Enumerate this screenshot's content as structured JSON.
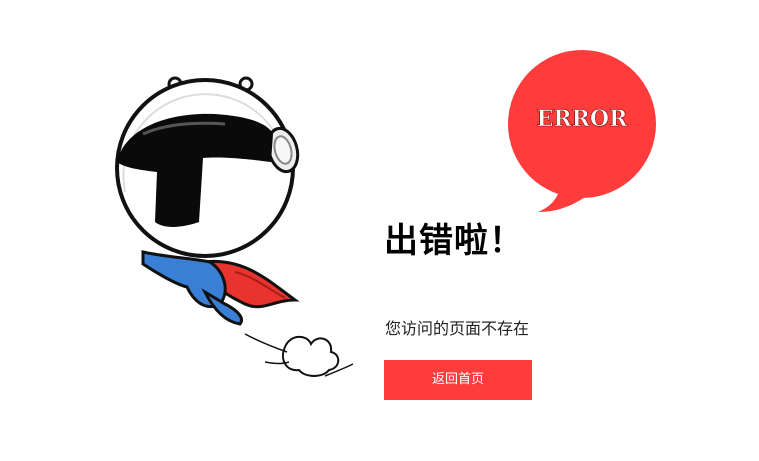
{
  "error_page": {
    "title": "出错啦！",
    "message": "您访问的页面不存在",
    "home_button_label": "返回首页",
    "badge_text": "ERROR"
  },
  "colors": {
    "accent": "#ff3c3c",
    "bubble": "#ff3c3c",
    "cape": "#e8332e",
    "suit": "#3a7fd6",
    "visor": "#0a0a0a"
  },
  "icons": {
    "mascot": "astronaut-mascot-icon",
    "bubble": "error-speech-bubble-icon"
  }
}
